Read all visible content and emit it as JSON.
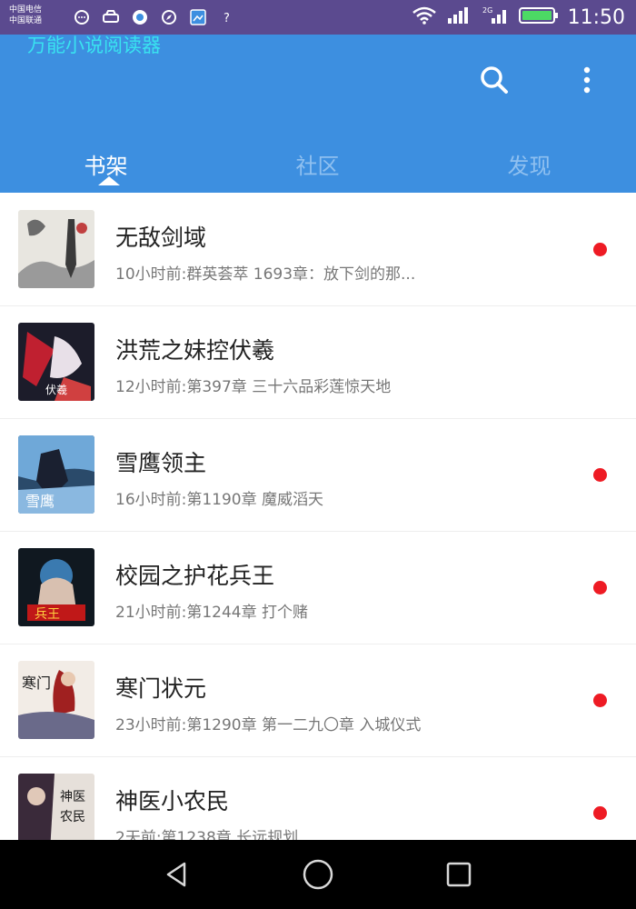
{
  "status_bar": {
    "carrier_1": "中国电信",
    "carrier_2": "中国联通",
    "network": "2G",
    "time": "11:50",
    "battery_color": "#4cd964"
  },
  "app_bar": {
    "title": "万能小说阅读器",
    "search_icon": "search-icon",
    "more_icon": "more-vertical-icon",
    "color": "#3d8fe0"
  },
  "tabs": [
    {
      "label": "书架",
      "active": true
    },
    {
      "label": "社区",
      "active": false
    },
    {
      "label": "发现",
      "active": false
    }
  ],
  "books": [
    {
      "title": "无敌剑域",
      "update": "10小时前:群英荟萃 1693章：放下剑的那...",
      "unread": true
    },
    {
      "title": "洪荒之妹控伏羲",
      "update": "12小时前:第397章 三十六品彩莲惊天地",
      "unread": false
    },
    {
      "title": "雪鹰领主",
      "update": "16小时前:第1190章 魔威滔天",
      "unread": true
    },
    {
      "title": "校园之护花兵王",
      "update": "21小时前:第1244章 打个赌",
      "unread": true
    },
    {
      "title": "寒门状元",
      "update": "23小时前:第1290章 第一二九〇章 入城仪式",
      "unread": true
    },
    {
      "title": "神医小农民",
      "update": "2天前:第1238章 长远规划",
      "unread": true
    }
  ],
  "nav_bar": {
    "back_icon": "back-icon",
    "home_icon": "home-icon",
    "recents_icon": "recents-icon"
  },
  "colors": {
    "unread_dot": "#ee1b24",
    "status_bar": "#5b4a8f",
    "accent_title": "#39e3f0"
  }
}
